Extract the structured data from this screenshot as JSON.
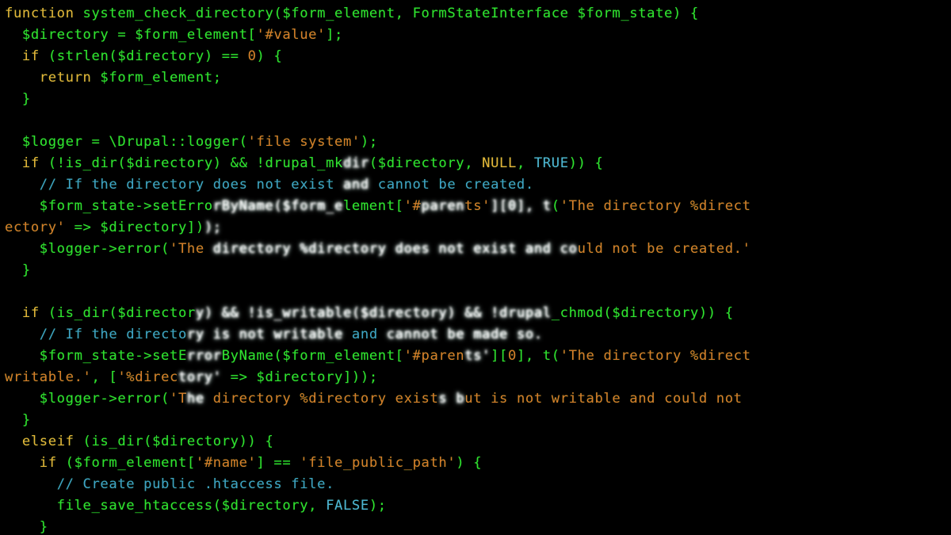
{
  "code": {
    "l01a": "function",
    "l01b": " system_check_directory",
    "l01c": "($form_element, FormStateInterface $form_state) {",
    "l02a": "  $directory = $form_element[",
    "l02b": "'#value'",
    "l02c": "];",
    "l03a": "  ",
    "l03b": "if",
    "l03c": " (strlen($directory) == ",
    "l03d": "0",
    "l03e": ") {",
    "l04a": "    ",
    "l04b": "return",
    "l04c": " $form_element;",
    "l05a": "  }",
    "l06a": "",
    "l07a": "  $logger = \\Drupal::logger(",
    "l07b": "'file system'",
    "l07c": ");",
    "l08a": "  ",
    "l08b": "if",
    "l08c": " (!is_dir($directory) && !drupal_mk",
    "l08d": "dir",
    "l08e": "($directory, ",
    "l08f": "NULL",
    "l08g": ", ",
    "l08h": "TRUE",
    "l08i": ")) {",
    "l09a": "    ",
    "l09b": "// If the directory does not exist ",
    "l09c": "and",
    "l09d": " cannot be created.",
    "l10a": "    $form_state->setErro",
    "l10b": "rByName($form_e",
    "l10c": "lement[",
    "l10d": "'#",
    "l10e": "paren",
    "l10f": "ts'",
    "l10g": "][",
    "l10h": "0",
    "l10i": "], ",
    "l10j": "t",
    "l10k": "(",
    "l10l": "'The directory %direct",
    "l11a": "ectory'",
    "l11b": " => $directory])",
    "l11c": ");",
    "l12a": "    $logger->error(",
    "l12b": "'The ",
    "l12c": "directory %directory does not exist and co",
    "l12d": "uld not be created.'",
    "l13a": "  }",
    "l14a": "",
    "l15a": "  ",
    "l15b": "if",
    "l15c": " (is_dir($director",
    "l15d": "y) && !is_writable($directory) && !drupal",
    "l15e": "_chmod($directory)) {",
    "l16a": "    ",
    "l16b": "// If the directo",
    "l16c": "ry is not writable",
    "l16d": " and ",
    "l16e": "cannot be made so.",
    "l17a": "    $form_state->setE",
    "l17b": "rror",
    "l17c": "ByName($form_element[",
    "l17d": "'#paren",
    "l17e": "ts'",
    "l17f": "][",
    "l17g": "0",
    "l17h": "], t(",
    "l17i": "'The directory %direct",
    "l18a": "writable.'",
    "l18b": ", [",
    "l18c": "'%direc",
    "l18d": "tory'",
    "l18e": " => $directory]));",
    "l19a": "    $logger->error(",
    "l19b": "'T",
    "l19c": "he",
    "l19d": " directory %directory exist",
    "l19e": "s b",
    "l19f": "ut is not writable and could not ",
    "l20a": "  }",
    "l21a": "  ",
    "l21b": "elseif",
    "l21c": " (is_dir($directory)) {",
    "l22a": "    ",
    "l22b": "if",
    "l22c": " ($form_element[",
    "l22d": "'#name'",
    "l22e": "] == ",
    "l22f": "'file_public_path'",
    "l22g": ") {",
    "l23a": "      ",
    "l23b": "// Create public .htaccess file.",
    "l24a": "      file_save_htaccess($directory, ",
    "l24b": "FALSE",
    "l24c": ");",
    "l25a": "    }"
  }
}
